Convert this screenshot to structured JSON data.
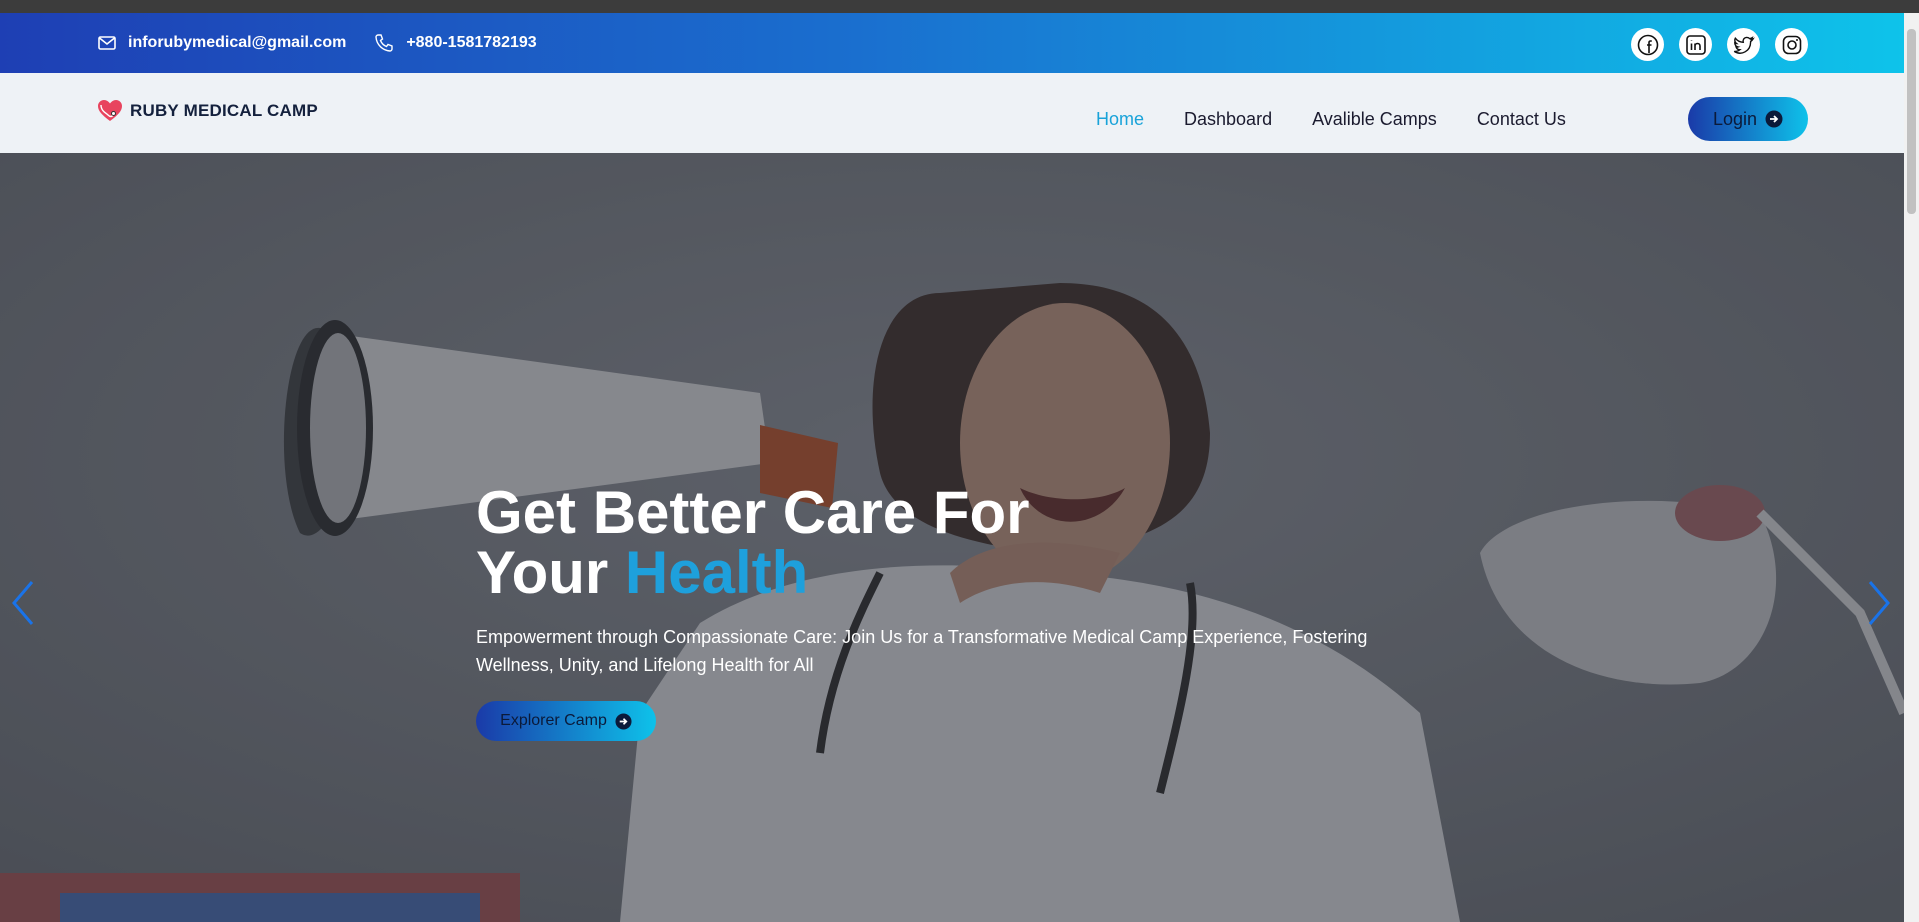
{
  "topbar": {
    "email": "inforubymedical@gmail.com",
    "phone": "+880-1581782193",
    "email_icon": "mail-icon",
    "phone_icon": "phone-icon",
    "socials": [
      "facebook-icon",
      "linkedin-icon",
      "twitter-icon",
      "instagram-icon"
    ]
  },
  "navbar": {
    "brand": "RUBY MEDICAL CAMP",
    "links": [
      "Home",
      "Dashboard",
      "Avalible Camps",
      "Contact Us"
    ],
    "active_link": "Home",
    "login_label": "Login"
  },
  "hero": {
    "title_line1": "Get Better Care For",
    "title_line2_plain": "Your ",
    "title_line2_accent": "Health",
    "subtitle": "Empowerment through Compassionate Care: Join Us for a Transformative Medical Camp Experience, Fostering Wellness, Unity, and Lifelong Health for All",
    "cta_label": "Explorer Camp"
  },
  "colors": {
    "accent": "#1ea0dc",
    "gradient_start": "#1a3aa8",
    "gradient_end": "#0ec2ea"
  }
}
